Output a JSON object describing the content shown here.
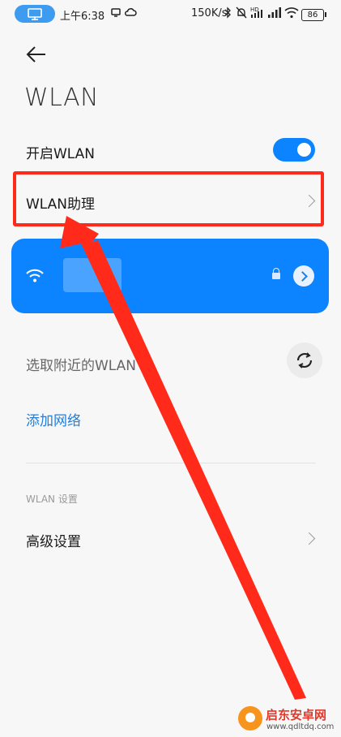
{
  "status_bar": {
    "time": "上午6:38",
    "speed": "150K/s",
    "battery": "86"
  },
  "header": {
    "title": "WLAN"
  },
  "settings": {
    "enable_wlan_label": "开启WLAN",
    "enable_wlan_on": true,
    "assistant_label": "WLAN助理",
    "nearby_label": "选取附近的WLAN",
    "add_network_label": "添加网络",
    "section_label": "WLAN 设置",
    "advanced_label": "高级设置"
  },
  "colors": {
    "accent": "#0d84ff",
    "annotation": "#ff2a1a",
    "link": "#1f7fe0"
  },
  "watermark": {
    "title": "启东安卓网",
    "url": "www.qdltdq.com"
  }
}
